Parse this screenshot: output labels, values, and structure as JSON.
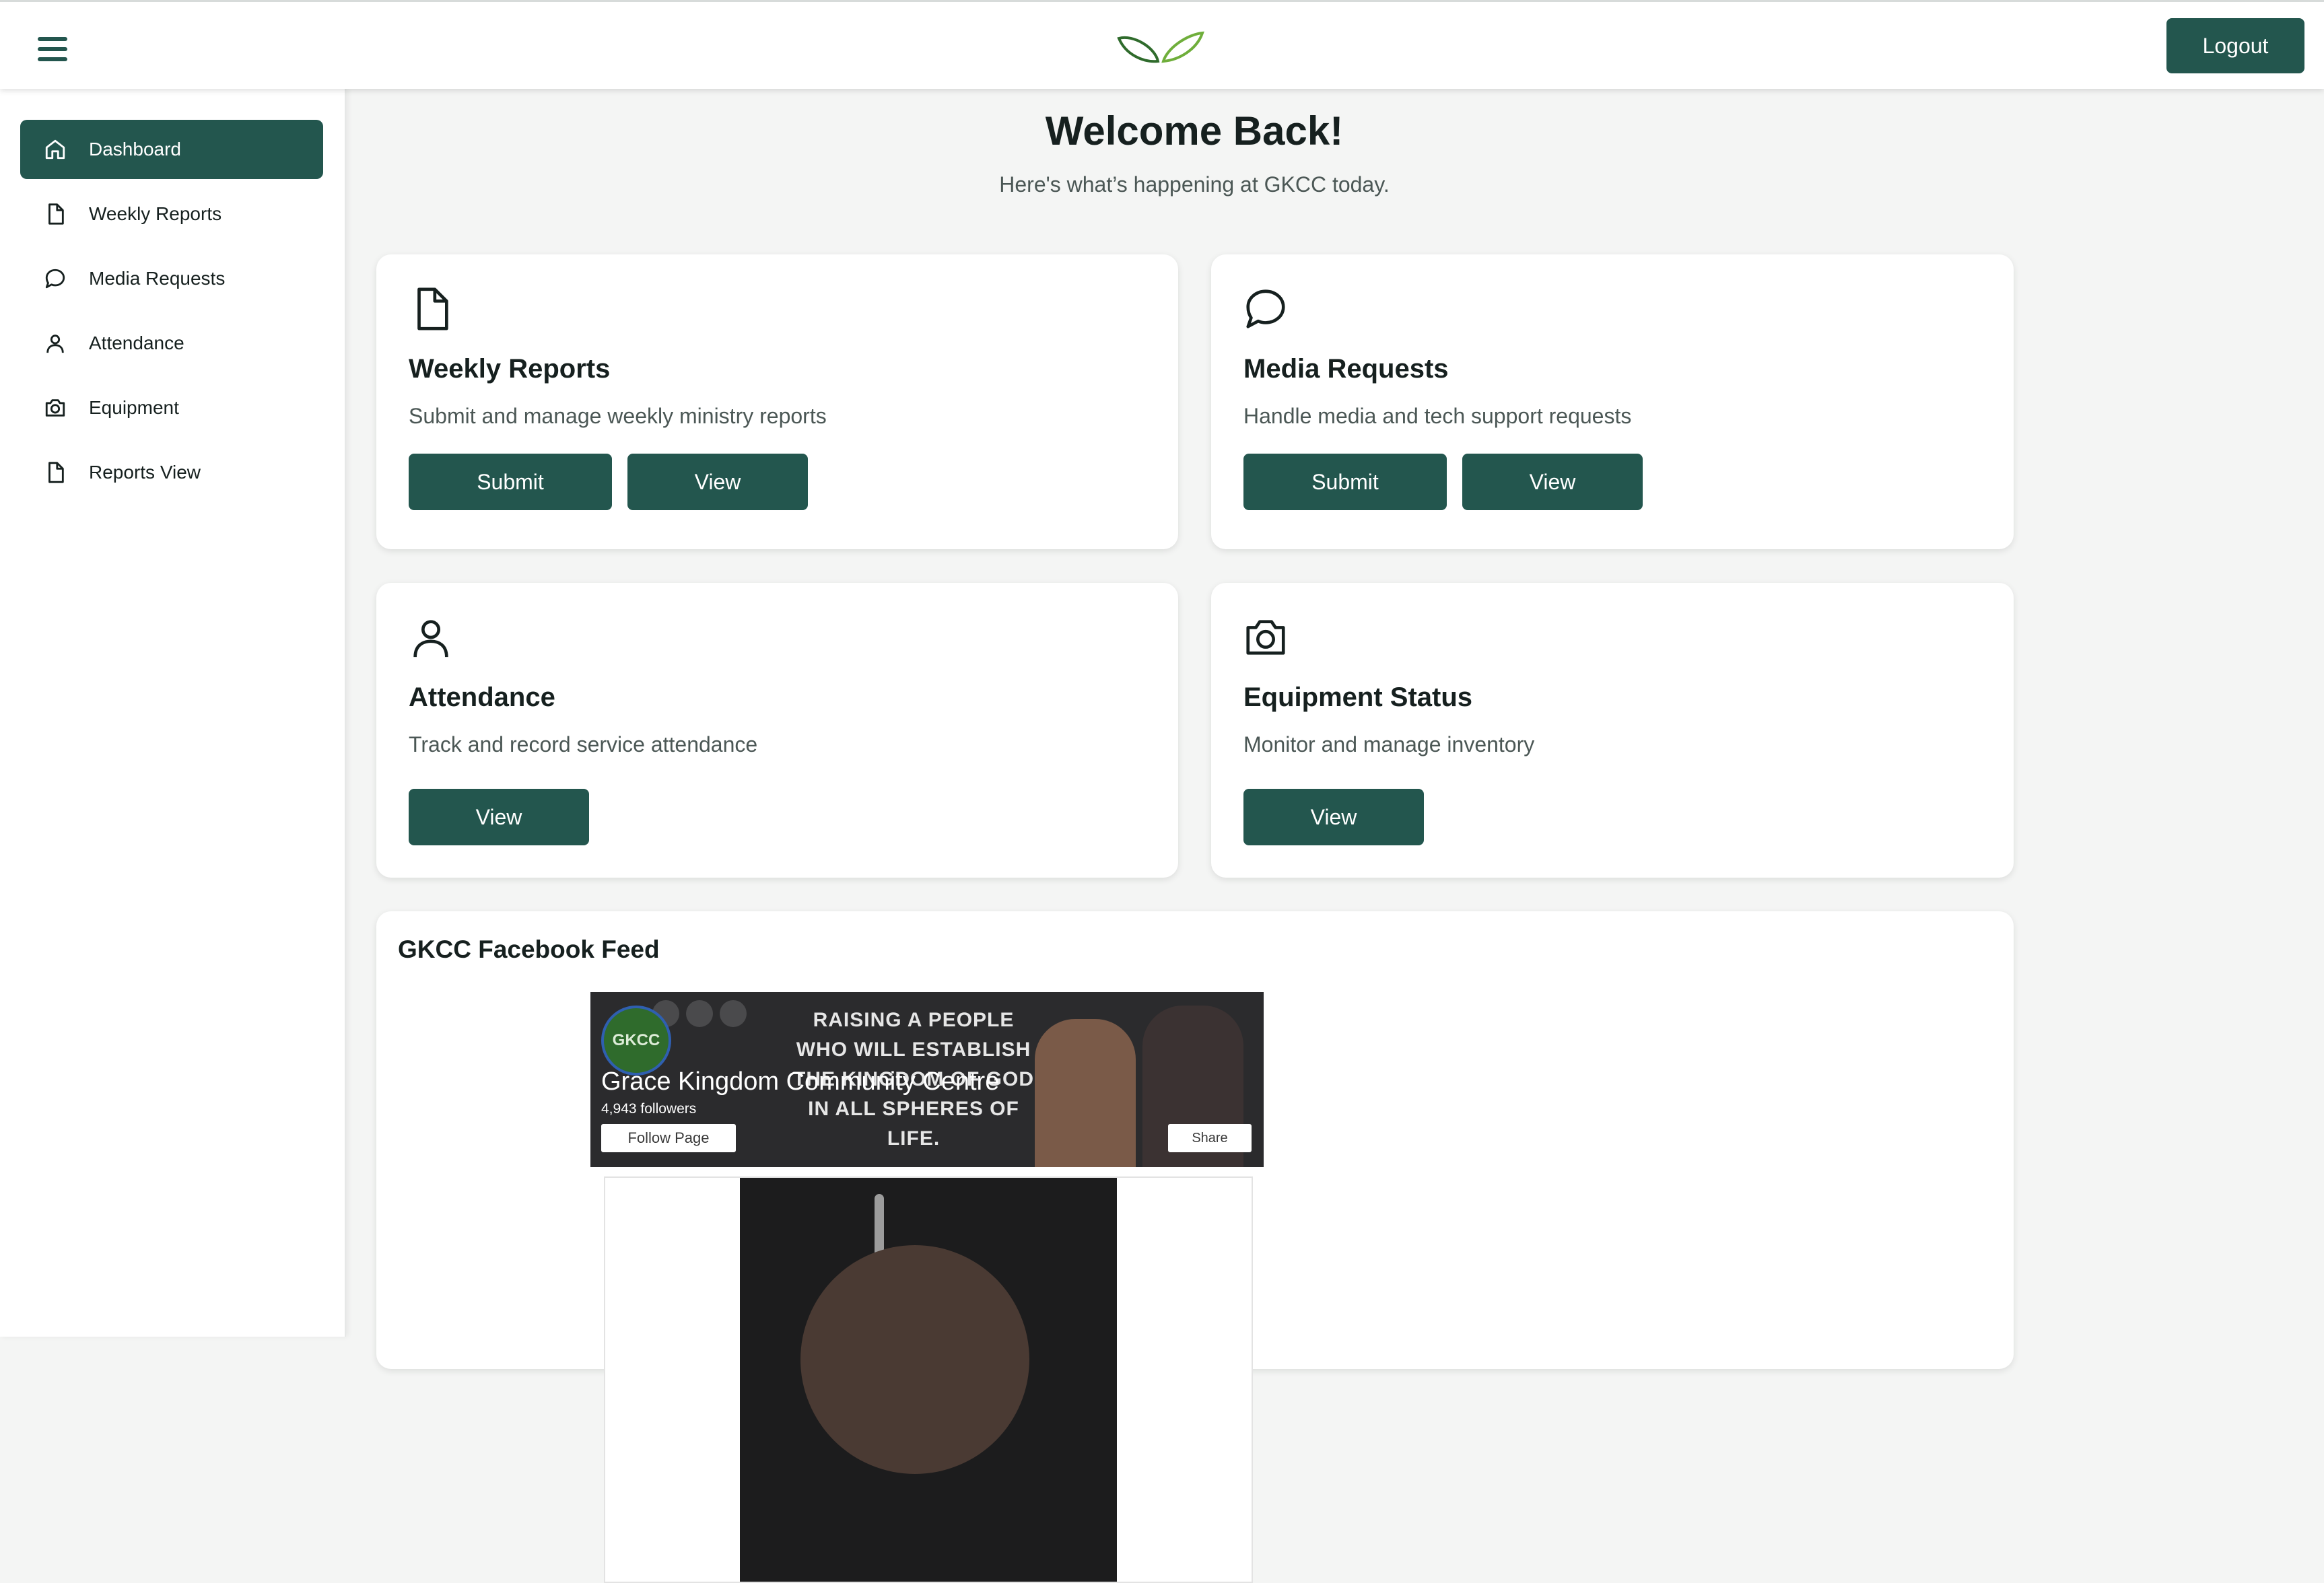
{
  "header": {
    "logout_label": "Logout",
    "logo_icon": "leaf-logo"
  },
  "sidebar": {
    "items": [
      {
        "label": "Dashboard",
        "icon": "home-icon",
        "active": true
      },
      {
        "label": "Weekly Reports",
        "icon": "file-icon"
      },
      {
        "label": "Media Requests",
        "icon": "chat-icon"
      },
      {
        "label": "Attendance",
        "icon": "user-icon"
      },
      {
        "label": "Equipment",
        "icon": "camera-icon"
      },
      {
        "label": "Reports View",
        "icon": "file-icon"
      }
    ]
  },
  "welcome": {
    "title": "Welcome Back!",
    "subtitle": "Here's what’s happening at GKCC today."
  },
  "cards": {
    "weekly": {
      "title": "Weekly Reports",
      "desc": "Submit and manage weekly ministry reports",
      "submit": "Submit",
      "view": "View"
    },
    "media": {
      "title": "Media Requests",
      "desc": "Handle media and tech support requests",
      "submit": "Submit",
      "view": "View"
    },
    "attendance": {
      "title": "Attendance",
      "desc": "Track and record service attendance",
      "view": "View"
    },
    "equipment": {
      "title": "Equipment Status",
      "desc": "Monitor and manage inventory",
      "view": "View"
    }
  },
  "feed": {
    "title": "GKCC Facebook Feed",
    "page_name": "Grace Kingdom Community Centre",
    "followers": "4,943 followers",
    "follow_label": "Follow Page",
    "share_label": "Share",
    "avatar_text": "GKCC",
    "cover_tagline": "RAISING A PEOPLE WHO WILL ESTABLISH THE KINGDOM OF GOD IN ALL SPHERES OF LIFE."
  },
  "colors": {
    "primary": "#23564e",
    "background": "#f4f5f4"
  }
}
